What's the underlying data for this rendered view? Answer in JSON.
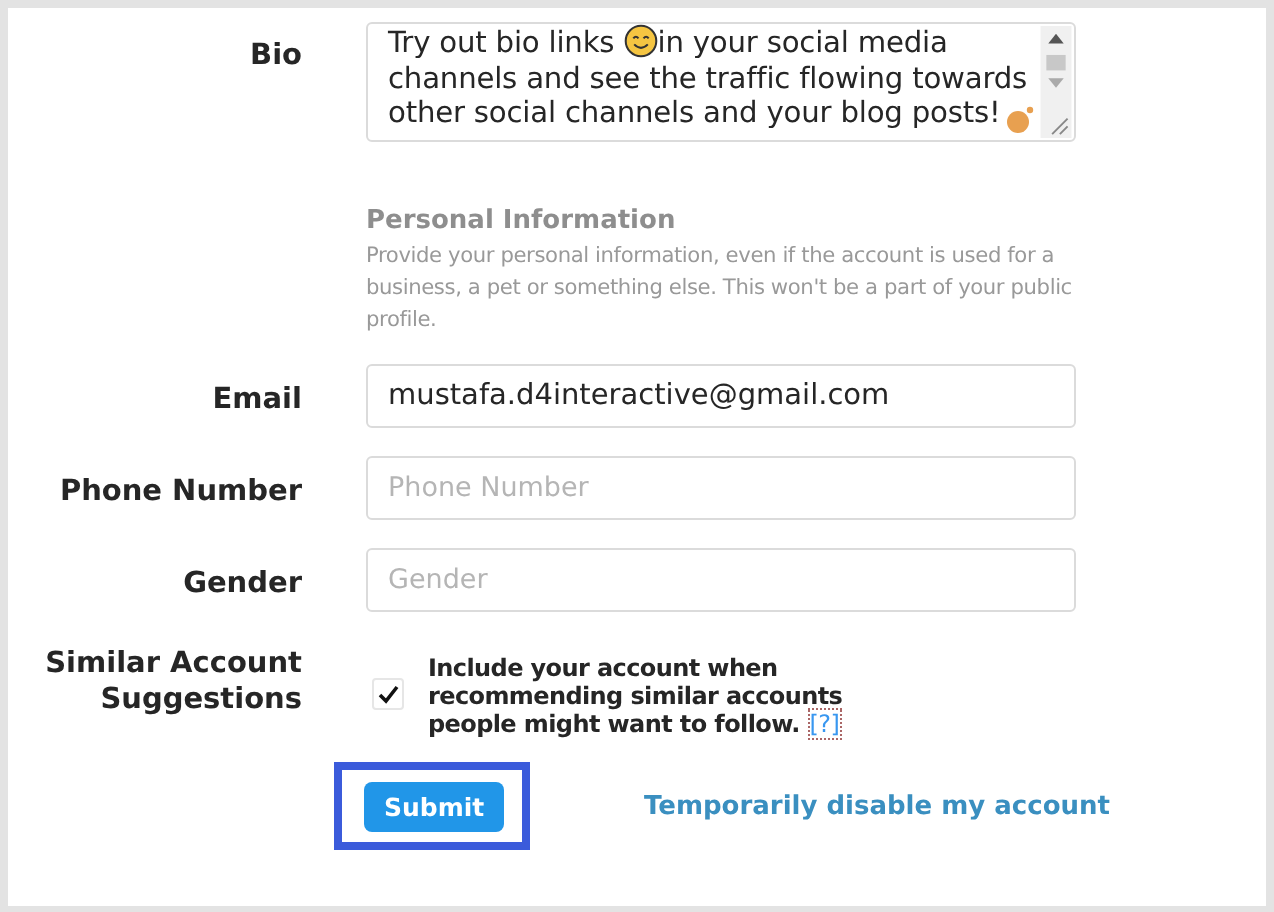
{
  "bio": {
    "label": "Bio",
    "text_before": "Try out bio links ",
    "text_after": "in your social media channels and see the traffic flowing towards other social channels and your blog posts!"
  },
  "personal_information": {
    "heading": "Personal Information",
    "description": "Provide your personal information, even if the account is used for a business, a pet or something else. This won't be a part of your public profile."
  },
  "fields": [
    {
      "label": "Email",
      "value": "mustafa.d4interactive@gmail.com"
    },
    {
      "label": "Phone Number",
      "placeholder": "Phone Number"
    },
    {
      "label": "Gender",
      "placeholder": "Gender"
    }
  ],
  "similar_accounts": {
    "label": "Similar Account Suggestions",
    "checked": true,
    "text": "Include your account when recommending similar accounts people might want to follow.",
    "help_link": "[?]"
  },
  "submit": {
    "label": "Submit",
    "highlighted": true
  },
  "disable_link": "Temporarily disable my account"
}
